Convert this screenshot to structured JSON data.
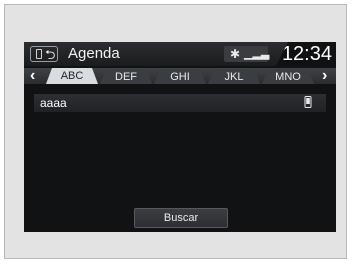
{
  "header": {
    "title": "Agenda",
    "time": "12:34"
  },
  "icons": {
    "phone": "phone-icon",
    "back": "back-icon",
    "bluetooth": "bluetooth-icon",
    "signal": "signal-icon",
    "arrow_left": "chevron-left-icon",
    "arrow_right": "chevron-right-icon"
  },
  "tabs": [
    "ABC",
    "DEF",
    "GHI",
    "JKL",
    "MNO"
  ],
  "active_tab": "ABC",
  "contacts": [
    {
      "name": "aaaa"
    }
  ],
  "search_button": "Buscar"
}
